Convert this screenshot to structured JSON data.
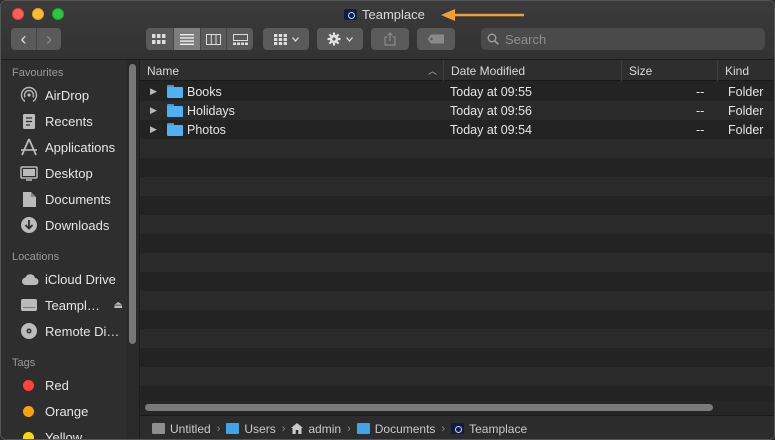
{
  "window": {
    "title": "Teamplace"
  },
  "toolbar": {
    "back_glyph": "‹",
    "forward_glyph": "›",
    "search_placeholder": "Search"
  },
  "sidebar": {
    "favourites_header": "Favourites",
    "favourites": [
      {
        "label": "AirDrop",
        "icon": "airdrop-icon"
      },
      {
        "label": "Recents",
        "icon": "recents-icon"
      },
      {
        "label": "Applications",
        "icon": "applications-icon"
      },
      {
        "label": "Desktop",
        "icon": "desktop-icon"
      },
      {
        "label": "Documents",
        "icon": "documents-icon"
      },
      {
        "label": "Downloads",
        "icon": "downloads-icon"
      }
    ],
    "locations_header": "Locations",
    "locations": [
      {
        "label": "iCloud Drive",
        "icon": "cloud-icon"
      },
      {
        "label": "Teampl…",
        "icon": "drive-icon"
      },
      {
        "label": "Remote Di…",
        "icon": "disc-icon"
      }
    ],
    "tags_header": "Tags",
    "tags": [
      {
        "label": "Red",
        "color": "#ff453a"
      },
      {
        "label": "Orange",
        "color": "#ff9f0a"
      },
      {
        "label": "Yellow",
        "color": "#ffd60a"
      }
    ]
  },
  "list": {
    "columns": {
      "name": "Name",
      "date": "Date Modified",
      "size": "Size",
      "kind": "Kind"
    },
    "rows": [
      {
        "name": "Books",
        "date": "Today at 09:55",
        "size": "--",
        "kind": "Folder"
      },
      {
        "name": "Holidays",
        "date": "Today at 09:56",
        "size": "--",
        "kind": "Folder"
      },
      {
        "name": "Photos",
        "date": "Today at 09:54",
        "size": "--",
        "kind": "Folder"
      }
    ]
  },
  "pathbar": {
    "crumbs": [
      "Untitled",
      "Users",
      "admin",
      "Documents",
      "Teamplace"
    ]
  },
  "colors": {
    "accent_arrow": "#f0a030",
    "folder": "#4fb2f0"
  }
}
